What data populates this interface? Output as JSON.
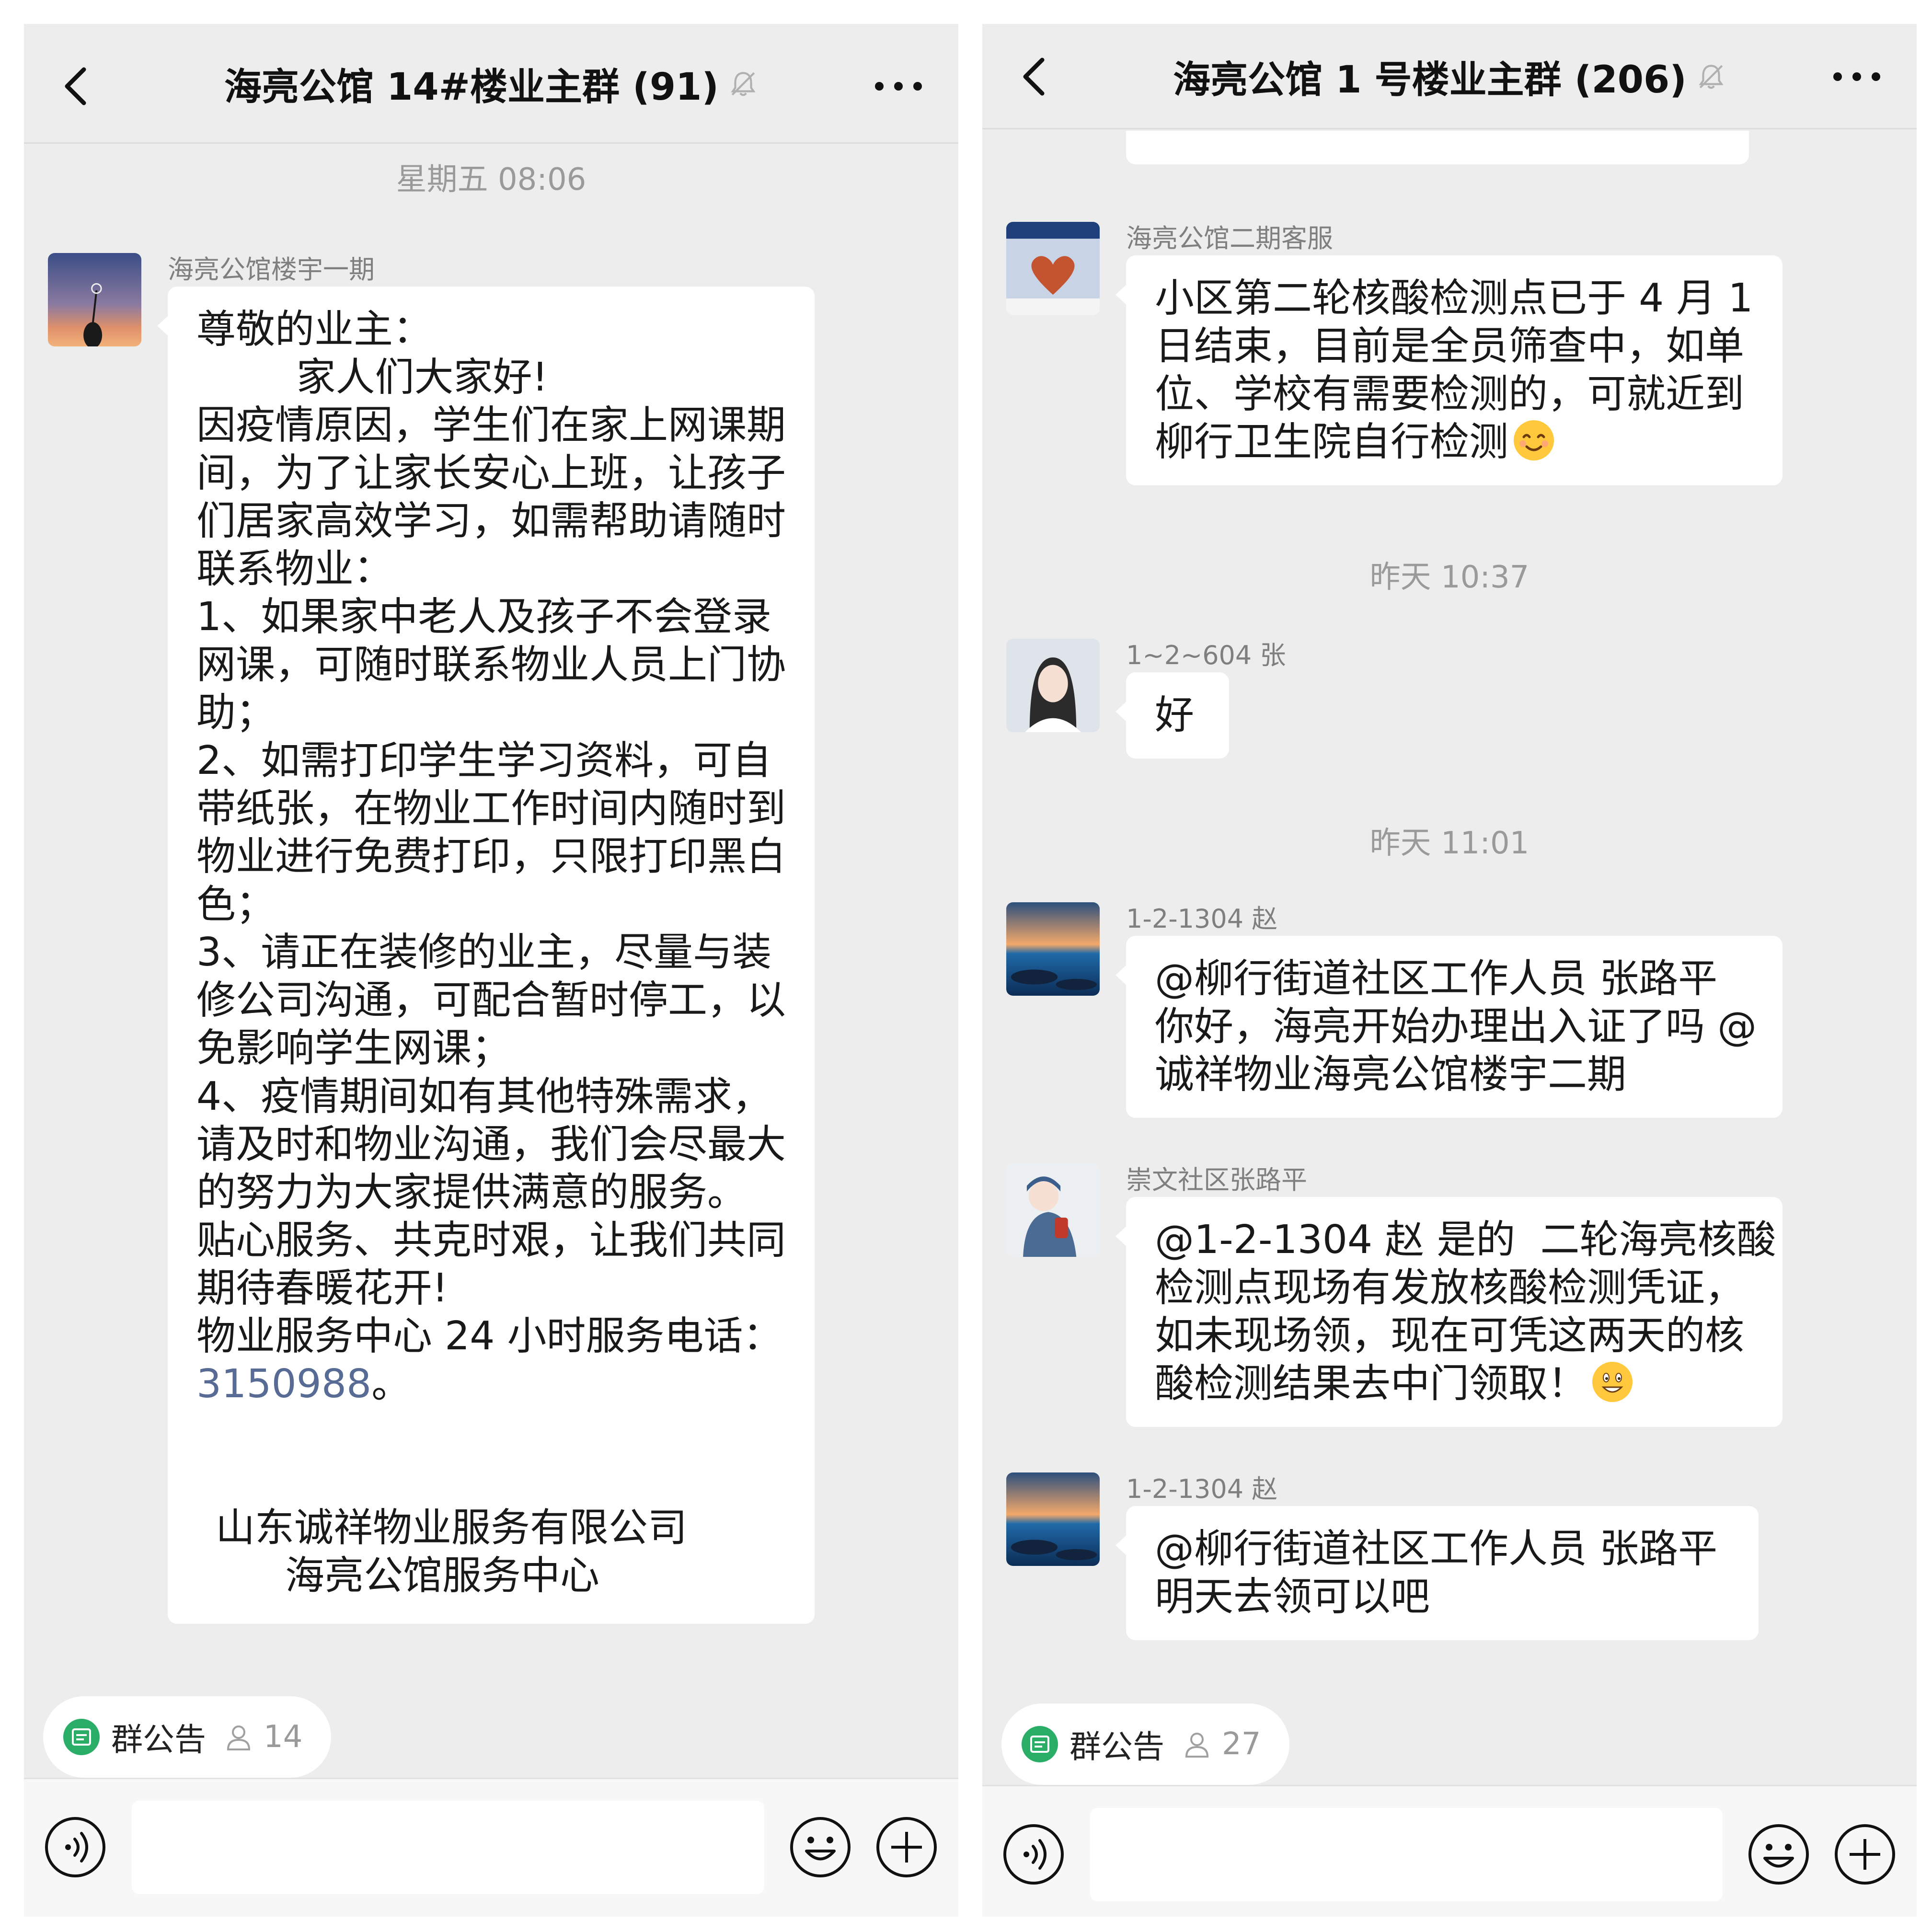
{
  "left": {
    "title": "海亮公馆 14#楼业主群 (91)",
    "timestamp": "星期五 08:06",
    "message": {
      "sender": "海亮公馆楼宇一期",
      "lines": [
        "尊敬的业主：",
        "        家人们大家好!",
        "因疫情原因，学生们在家上网课期",
        "间，为了让家长安心上班，让孩子",
        "们居家高效学习，如需帮助请随时",
        "联系物业：",
        "1、如果家中老人及孩子不会登录",
        "网课，可随时联系物业人员上门协",
        "助；",
        "2、如需打印学生学习资料，可自",
        "带纸张，在物业工作时间内随时到",
        "物业进行免费打印，只限打印黑白",
        "色；",
        "3、请正在装修的业主，尽量与装",
        "修公司沟通，可配合暂时停工，以",
        "免影响学生网课；",
        "4、疫情期间如有其他特殊需求，",
        "请及时和物业沟通，我们会尽最大",
        "的努力为大家提供满意的服务。",
        "贴心服务、共克时艰，让我们共同",
        "期待春暖花开!",
        "物业服务中心 24 小时服务电话："
      ],
      "phone": "3150988",
      "phone_suffix": "。",
      "signature_company": "山东诚祥物业服务有限公司",
      "signature_center": "海亮公馆服务中心"
    },
    "notice": {
      "label": "群公告",
      "count": "14"
    }
  },
  "right": {
    "title": "海亮公馆 1 号楼业主群 (206)",
    "messages": [
      {
        "sender": "海亮公馆二期客服",
        "lines": [
          "小区第二轮核酸检测点已于 4 月 1",
          "日结束，目前是全员筛查中，如单",
          "位、学校有需要检测的，可就近到",
          "柳行卫生院自行检测"
        ],
        "emoji": "smile-emoji"
      },
      {
        "time": "昨天 10:37"
      },
      {
        "sender": "1~2~604 张",
        "lines": [
          "好"
        ]
      },
      {
        "time": "昨天 11:01"
      },
      {
        "sender": "1-2-1304 赵",
        "lines": [
          "@柳行街道社区工作人员 张路平",
          "你好，海亮开始办理出入证了吗 @",
          "诚祥物业海亮公馆楼宇二期"
        ]
      },
      {
        "sender": "崇文社区张路平",
        "lines": [
          "@1-2-1304 赵 是的  二轮海亮核酸",
          "检测点现场有发放核酸检测凭证，",
          "如未现场领，现在可凭这两天的核",
          "酸检测结果去中门领取！"
        ],
        "emoji": "grin-emoji"
      },
      {
        "sender": "1-2-1304 赵",
        "lines": [
          "@柳行街道社区工作人员 张路平",
          "明天去领可以吧"
        ]
      }
    ],
    "notice": {
      "label": "群公告",
      "count": "27"
    }
  },
  "colors": {
    "chat_background": "#ededed",
    "bubble": "#ffffff",
    "link": "#576b95",
    "notice_green": "#2aae67",
    "timestamp_gray": "#9a9a9a"
  },
  "icons": [
    "back-arrow-icon",
    "mute-bell-icon",
    "more-dots-icon",
    "notice-icon",
    "member-icon",
    "voice-icon",
    "emoji-icon",
    "plus-icon"
  ]
}
